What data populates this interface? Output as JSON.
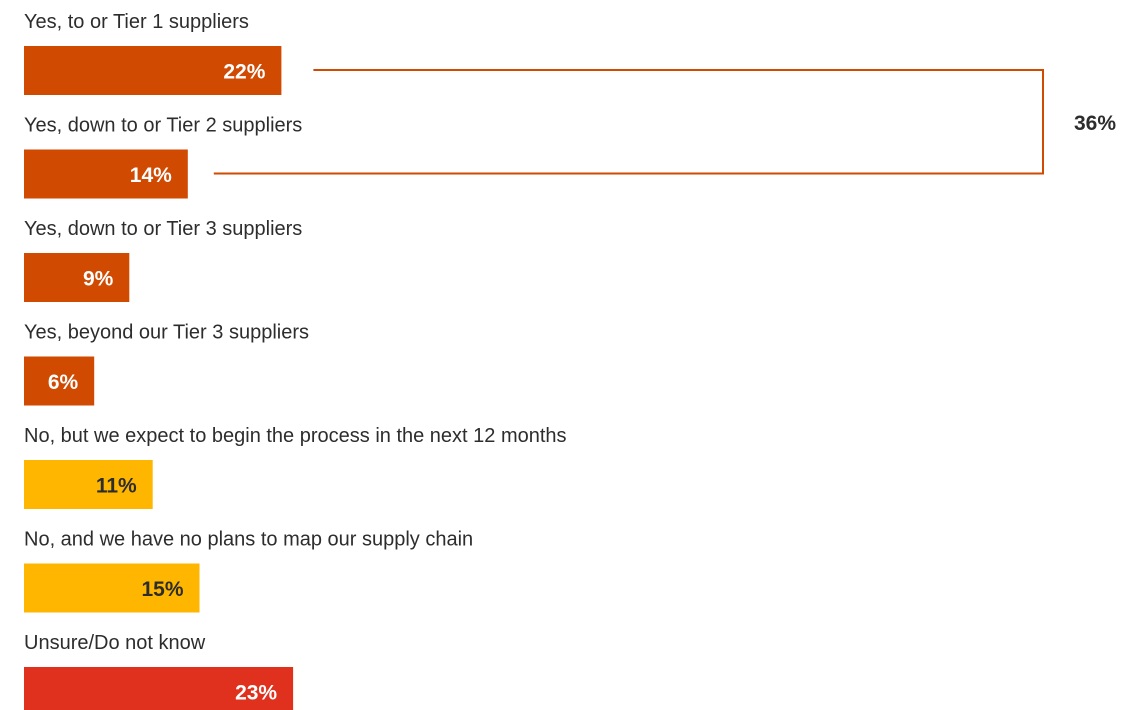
{
  "chart_data": {
    "type": "bar",
    "orientation": "horizontal",
    "categories": [
      "Yes, to or Tier 1 suppliers",
      "Yes, down to or Tier 2 suppliers",
      "Yes, down to or Tier 3 suppliers",
      "Yes, beyond our Tier 3 suppliers",
      "No, but we expect to begin the process in the next 12 months",
      "No, and we have no plans to map our supply chain",
      "Unsure/Do not know"
    ],
    "values": [
      22,
      14,
      9,
      6,
      11,
      15,
      23
    ],
    "value_labels": [
      "22%",
      "14%",
      "9%",
      "6%",
      "11%",
      "15%",
      "23%"
    ],
    "unit": "%",
    "bar_colors": [
      "#d04a02",
      "#d04a02",
      "#d04a02",
      "#d04a02",
      "#ffb600",
      "#ffb600",
      "#e0301e"
    ],
    "value_label_colors": [
      "#ffffff",
      "#ffffff",
      "#ffffff",
      "#ffffff",
      "#2d2d2d",
      "#2d2d2d",
      "#ffffff"
    ],
    "bracket": {
      "spans": [
        0,
        1
      ],
      "label": "36%",
      "color": "#d04a02"
    },
    "legend": "none",
    "grid": false
  }
}
